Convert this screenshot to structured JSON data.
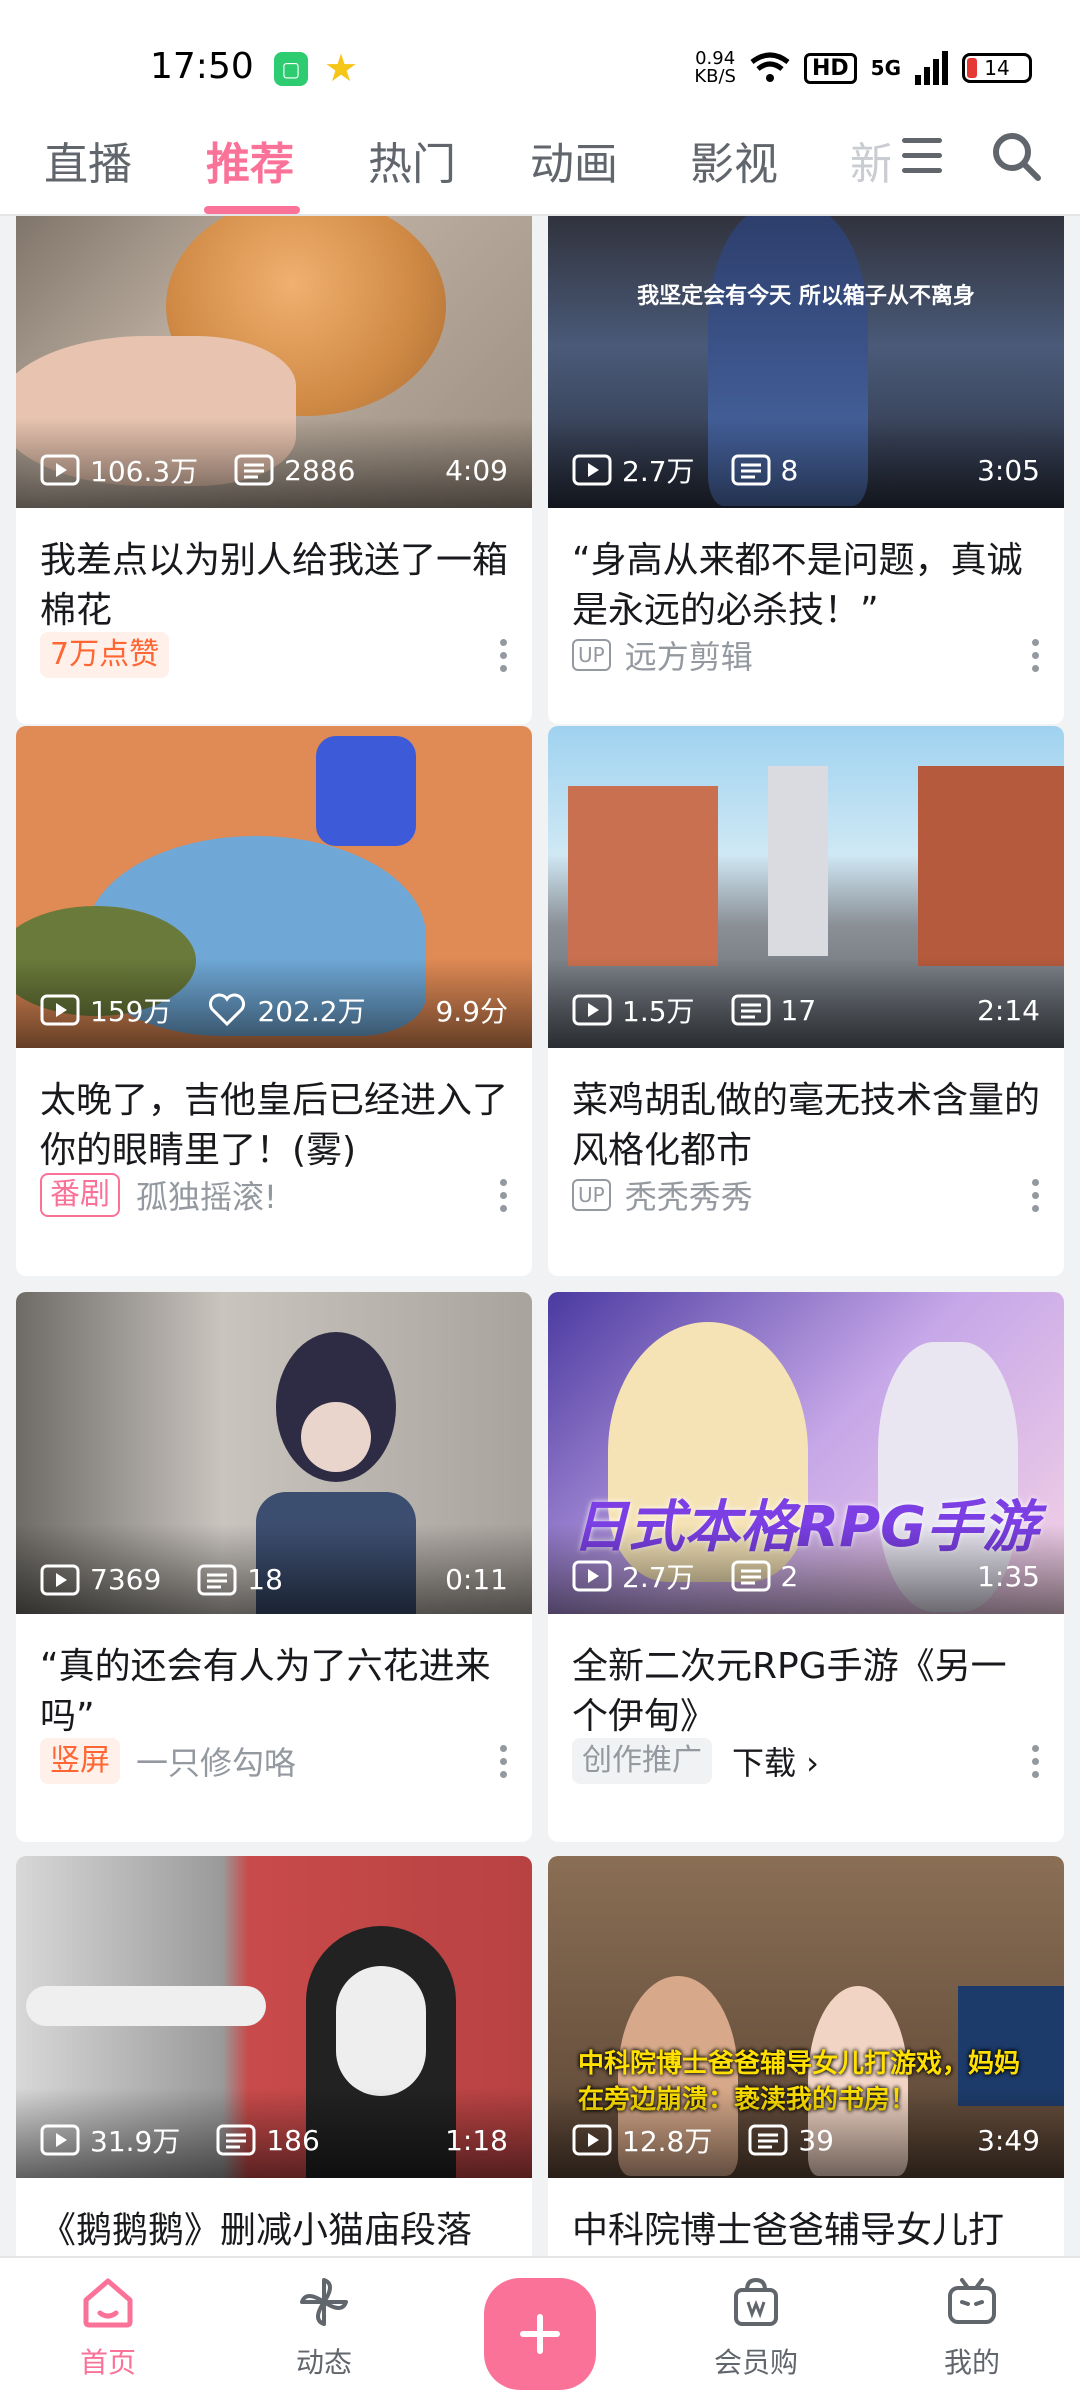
{
  "status": {
    "time": "17:50",
    "net_speed_value": "0.94",
    "net_speed_unit": "KB/S",
    "hd": "HD",
    "net_type": "5G",
    "battery": "14"
  },
  "tabs": [
    "直播",
    "推荐",
    "热门",
    "动画",
    "影视",
    "新"
  ],
  "active_tab": "推荐",
  "cards": [
    {
      "views": "106.3万",
      "comments": "2886",
      "duration": "4:09",
      "title": "我差点以为别人给我送了一箱棉花",
      "badge": "7万点赞",
      "author": ""
    },
    {
      "views": "2.7万",
      "comments": "8",
      "duration": "3:05",
      "title": "“身高从来都不是问题，真诚是永远的必杀技！”",
      "badge": "UP",
      "author": "远方剪辑",
      "overlay_text": "我坚定会有今天  所以箱子从不离身"
    },
    {
      "views": "159万",
      "likes": "202.2万",
      "score": "9.9分",
      "title": "太晚了，吉他皇后已经进入了你的眼睛里了！(雾)",
      "badge": "番剧",
      "author": "孤独摇滚!"
    },
    {
      "views": "1.5万",
      "comments": "17",
      "duration": "2:14",
      "title": "菜鸡胡乱做的毫无技术含量的风格化都市",
      "badge": "UP",
      "author": "秃秃秀秀"
    },
    {
      "views": "7369",
      "comments": "18",
      "duration": "0:11",
      "title": "“真的还会有人为了六花进来吗”",
      "badge": "竖屏",
      "author": "一只修勾咯"
    },
    {
      "views": "2.7万",
      "comments": "2",
      "duration": "1:35",
      "title": "全新二次元RPG手游《另一个伊甸》",
      "badge": "创作推广",
      "author": "下载 ›",
      "overlay_text": "日式本格RPG手游"
    },
    {
      "views": "31.9万",
      "comments": "186",
      "duration": "1:18",
      "title": "《鹅鹅鹅》删减小猫庙段落",
      "badge": "",
      "author": ""
    },
    {
      "views": "12.8万",
      "comments": "39",
      "duration": "3:49",
      "title": "中科院博士爸爸辅导女儿打",
      "badge": "",
      "author": "",
      "overlay_text": "中科院博士爸爸辅导女儿打游戏，妈妈在旁边崩溃：亵渎我的书房！"
    }
  ],
  "bottom_nav": {
    "home": "首页",
    "dynamic": "动态",
    "vip": "会员购",
    "mine": "我的"
  },
  "colors": {
    "accent": "#fb7299",
    "text": "#18191c",
    "muted": "#9499a0"
  }
}
